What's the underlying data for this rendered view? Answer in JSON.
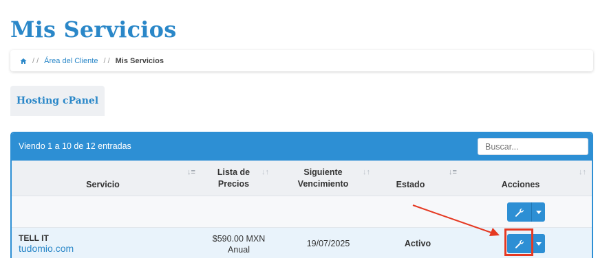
{
  "page": {
    "title": "Mis Servicios"
  },
  "breadcrumb": {
    "separator": "/ /",
    "items": [
      "Área del Cliente"
    ],
    "active": "Mis Servicios"
  },
  "tabs": [
    {
      "label": "Hosting cPanel"
    }
  ],
  "table": {
    "showing_text": "Viendo 1 a 10 de 12 entradas",
    "search_placeholder": "Buscar...",
    "columns": [
      {
        "label": "Servicio"
      },
      {
        "label": "Lista de Precios"
      },
      {
        "label": "Siguiente Vencimiento"
      },
      {
        "label": "Estado"
      },
      {
        "label": "Acciones"
      }
    ],
    "rows": [
      {
        "service_name": "TELL IT",
        "domain": "tudomio.com",
        "price": "$590.00 MXN",
        "cycle": "Anual",
        "next_due": "19/07/2025",
        "status": "Activo"
      }
    ]
  },
  "colors": {
    "brand": "#2a87c8",
    "table_header": "#2d8fd4",
    "annotation": "#e53922"
  },
  "icons": [
    "home-icon",
    "wrench-icon",
    "caret-down-icon",
    "sort-icon"
  ]
}
